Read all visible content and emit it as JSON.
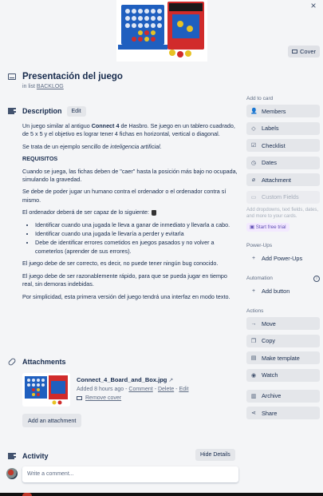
{
  "cover": {
    "button_label": "Cover",
    "close_glyph": "×"
  },
  "card": {
    "title": "Presentación del juego",
    "in_list_prefix": "in list",
    "list_name": "BACKLOG"
  },
  "description": {
    "heading": "Description",
    "edit_label": "Edit",
    "p1_a": "Un juego similar al antiguo ",
    "p1_bold": "Connect 4",
    "p1_b": " de Hasbro. Se juego en un tablero cuadrado, de 5 x 5 y el objetivo es lograr tener 4 fichas en horizontal, vertical o diagonal.",
    "p2_a": "Se trata de un ejemplo sencillo de ",
    "p2_italic": "inteligencia artificial",
    "p2_b": ".",
    "requisitos": "REQUISITOS",
    "p3": "Cuando se juega, las fichas deben de \"caer\" hasta la posición más bajo no ocupada, simulando la gravedad.",
    "p4": "Se debe de poder jugar un humano contra el ordenador o el ordenador contra sí mismo.",
    "p5": "El ordenador deberá de ser capaz de lo siguiente:",
    "bullets": [
      "Identificar cuando una jugada le lleva a ganar de inmediato y llevarla a cabo.",
      "Identificar cuando una jugada le llevaría a perder y evitarla",
      "Debe de identificar errores cometidos en juegos pasados y no volver a cometerlos (aprender de sus errores)."
    ],
    "p6": "El juego debe de ser correcto, es decir, no puede tener ningún bug conocido.",
    "p7": "El juego debe de ser razonablemente rápido, para que se pueda jugar en tiempo real, sin demoras indebidas.",
    "p8": "Por simplicidad, esta primera versión del juego tendrá una interfaz en modo texto."
  },
  "attachments": {
    "heading": "Attachments",
    "file_name": "Connect_4_Board_and_Box.jpg",
    "arrow": "↗",
    "added": "Added 8 hours ago",
    "sep": " - ",
    "comment_link": "Comment",
    "delete_link": "Delete",
    "edit_link": "Edit",
    "remove_cover": "Remove cover",
    "add_button": "Add an attachment"
  },
  "activity": {
    "heading": "Activity",
    "hide_details": "Hide Details",
    "comment_placeholder": "Write a comment..."
  },
  "sidebar": {
    "add_to_card_label": "Add to card",
    "add_to_card": [
      {
        "icon": "members-icon",
        "label": "Members"
      },
      {
        "icon": "labels-icon",
        "label": "Labels"
      },
      {
        "icon": "checklist-icon",
        "label": "Checklist"
      },
      {
        "icon": "dates-icon",
        "label": "Dates"
      },
      {
        "icon": "attachment-icon",
        "label": "Attachment"
      }
    ],
    "custom_fields": "Custom Fields",
    "custom_fields_note": "Add dropdowns, text fields, dates, and more to your cards.",
    "free_trial": "Start free trial",
    "powerups_label": "Power-Ups",
    "add_powerups": "Add Power-Ups",
    "automation_label": "Automation",
    "add_button": "Add button",
    "actions_label": "Actions",
    "actions": [
      {
        "icon": "move-icon",
        "label": "Move"
      },
      {
        "icon": "copy-icon",
        "label": "Copy"
      },
      {
        "icon": "template-icon",
        "label": "Make template"
      },
      {
        "icon": "watch-icon",
        "label": "Watch"
      }
    ],
    "archive": "Archive",
    "share": "Share"
  },
  "colors": {
    "background": "#f4f5f7",
    "button": "#e4e6ea",
    "text": "#172b4d",
    "muted": "#5e6c84"
  }
}
